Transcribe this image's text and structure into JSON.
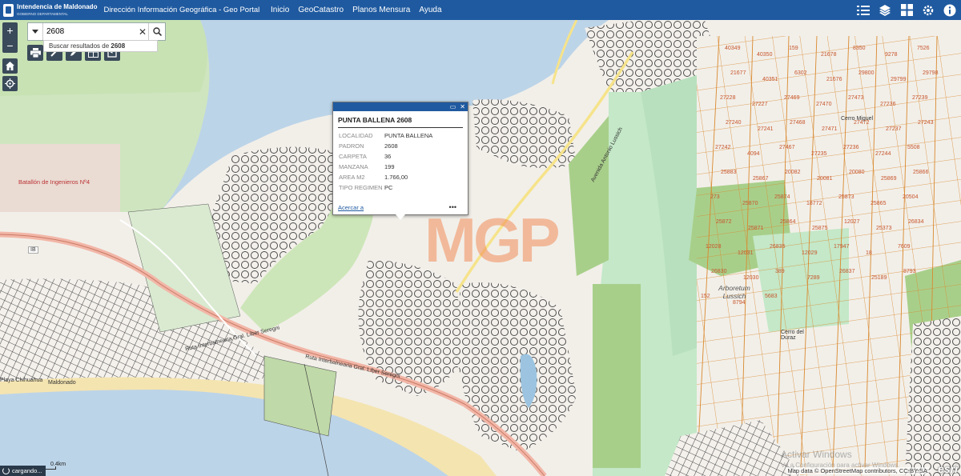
{
  "header": {
    "org_name": "Intendencia de Maldonado",
    "org_subtitle": "GOBIERNO DEPARTAMENTAL",
    "app_title": "Dirección Información Geográfica - Geo Portal",
    "nav": [
      "Inicio",
      "GeoCatastro",
      "Planos Mensura",
      "Ayuda"
    ],
    "tools": [
      "list-icon",
      "layers-icon",
      "basemap-grid-icon",
      "settings-gear-icon",
      "info-icon"
    ]
  },
  "search": {
    "value": "2608",
    "hint_prefix": "Buscar resultados de ",
    "hint_term": "2608"
  },
  "popup": {
    "title": "PUNTA BALLENA 2608",
    "fields": [
      {
        "key": "LOCALIDAD",
        "value": "PUNTA BALLENA"
      },
      {
        "key": "PADRON",
        "value": "2608"
      },
      {
        "key": "CARPETA",
        "value": "36"
      },
      {
        "key": "MANZANA",
        "value": "199"
      },
      {
        "key": "AREA M2",
        "value": "1.766,00"
      },
      {
        "key": "TIPO REGIMEN",
        "value": "PC"
      }
    ],
    "zoom_link": "Acercar a",
    "more": "•••"
  },
  "map": {
    "place_labels": {
      "batallon": "Batallón de Ingenieros Nº4",
      "arboretum": "Arboretum Lussich",
      "cerro_miguel": "Cerro Miguel",
      "cerro_duraz": "Cerro del Duraz",
      "maldonado": "Maldonado",
      "chihuahua": "Playa Chihuahua",
      "route_1": "Ruta Interbalnearia Gral. Líber Seregni",
      "route_2": "Ruta Interbalnearia Gral. Líber Seregni",
      "route_3": "Avenida Antonio Lussich",
      "ib": "IB"
    },
    "lots": [
      "40349",
      "40350",
      "159",
      "21678",
      "8350",
      "9278",
      "7526",
      "21677",
      "40351",
      "6302",
      "21676",
      "29800",
      "29799",
      "29798",
      "27228",
      "27227",
      "27469",
      "27470",
      "27473",
      "27236",
      "27239",
      "27240",
      "27241",
      "27468",
      "27471",
      "27472",
      "27237",
      "27243",
      "27242",
      "4094",
      "27467",
      "27235",
      "27236",
      "27244",
      "5508",
      "25883",
      "25867",
      "20082",
      "20081",
      "20080",
      "25869",
      "25866",
      "273",
      "25870",
      "25874",
      "18772",
      "25873",
      "25865",
      "20504",
      "25872",
      "25871",
      "25864",
      "25875",
      "12027",
      "25373",
      "26834",
      "12028",
      "12031",
      "26835",
      "12029",
      "17947",
      "18",
      "7609",
      "26830",
      "12030",
      "389",
      "7289",
      "26837",
      "25189",
      "8793",
      "152",
      "8794",
      "5683"
    ],
    "watermark_title": "Activar Windows",
    "watermark_sub": "Ve a Configuración para activar Windows.",
    "logo_overlay": "MGP"
  },
  "status": {
    "loading": "cargando...",
    "scale": "0.4km",
    "attribution": "Map data © OpenStreetMap contributors, CC-BY-SA",
    "esri": "esri"
  },
  "colors": {
    "header": "#1f5aa0",
    "water": "#bcd4e8",
    "land": "#f2efe9",
    "park": "#c8dfa8",
    "forest": "#a8cf8a",
    "lot_line": "#d9892e",
    "road": "#f2b6a7"
  }
}
